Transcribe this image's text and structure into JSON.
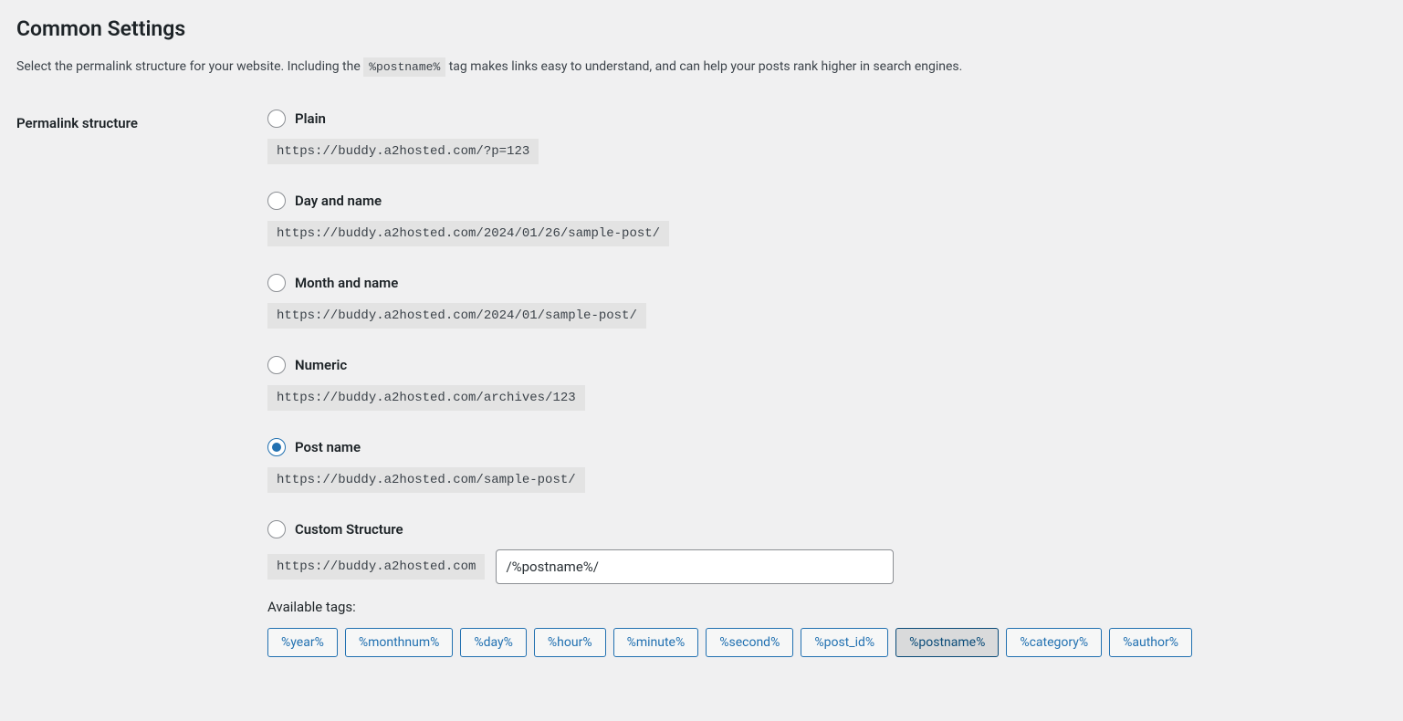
{
  "heading": "Common Settings",
  "description_pre": "Select the permalink structure for your website. Including the ",
  "description_code": "%postname%",
  "description_post": " tag makes links easy to understand, and can help your posts rank higher in search engines.",
  "row_label": "Permalink structure",
  "options": [
    {
      "label": "Plain",
      "example": "https://buddy.a2hosted.com/?p=123",
      "checked": false,
      "name": "permalink-option-plain",
      "radio_name": "radio-plain"
    },
    {
      "label": "Day and name",
      "example": "https://buddy.a2hosted.com/2024/01/26/sample-post/",
      "checked": false,
      "name": "permalink-option-day-name",
      "radio_name": "radio-day-name"
    },
    {
      "label": "Month and name",
      "example": "https://buddy.a2hosted.com/2024/01/sample-post/",
      "checked": false,
      "name": "permalink-option-month-name",
      "radio_name": "radio-month-name"
    },
    {
      "label": "Numeric",
      "example": "https://buddy.a2hosted.com/archives/123",
      "checked": false,
      "name": "permalink-option-numeric",
      "radio_name": "radio-numeric"
    },
    {
      "label": "Post name",
      "example": "https://buddy.a2hosted.com/sample-post/",
      "checked": true,
      "name": "permalink-option-post-name",
      "radio_name": "radio-post-name"
    }
  ],
  "custom": {
    "label": "Custom Structure",
    "base_url": "https://buddy.a2hosted.com",
    "input_value": "/%postname%/"
  },
  "available_tags_label": "Available tags:",
  "tags": [
    {
      "text": "%year%",
      "active": false
    },
    {
      "text": "%monthnum%",
      "active": false
    },
    {
      "text": "%day%",
      "active": false
    },
    {
      "text": "%hour%",
      "active": false
    },
    {
      "text": "%minute%",
      "active": false
    },
    {
      "text": "%second%",
      "active": false
    },
    {
      "text": "%post_id%",
      "active": false
    },
    {
      "text": "%postname%",
      "active": true
    },
    {
      "text": "%category%",
      "active": false
    },
    {
      "text": "%author%",
      "active": false
    }
  ]
}
